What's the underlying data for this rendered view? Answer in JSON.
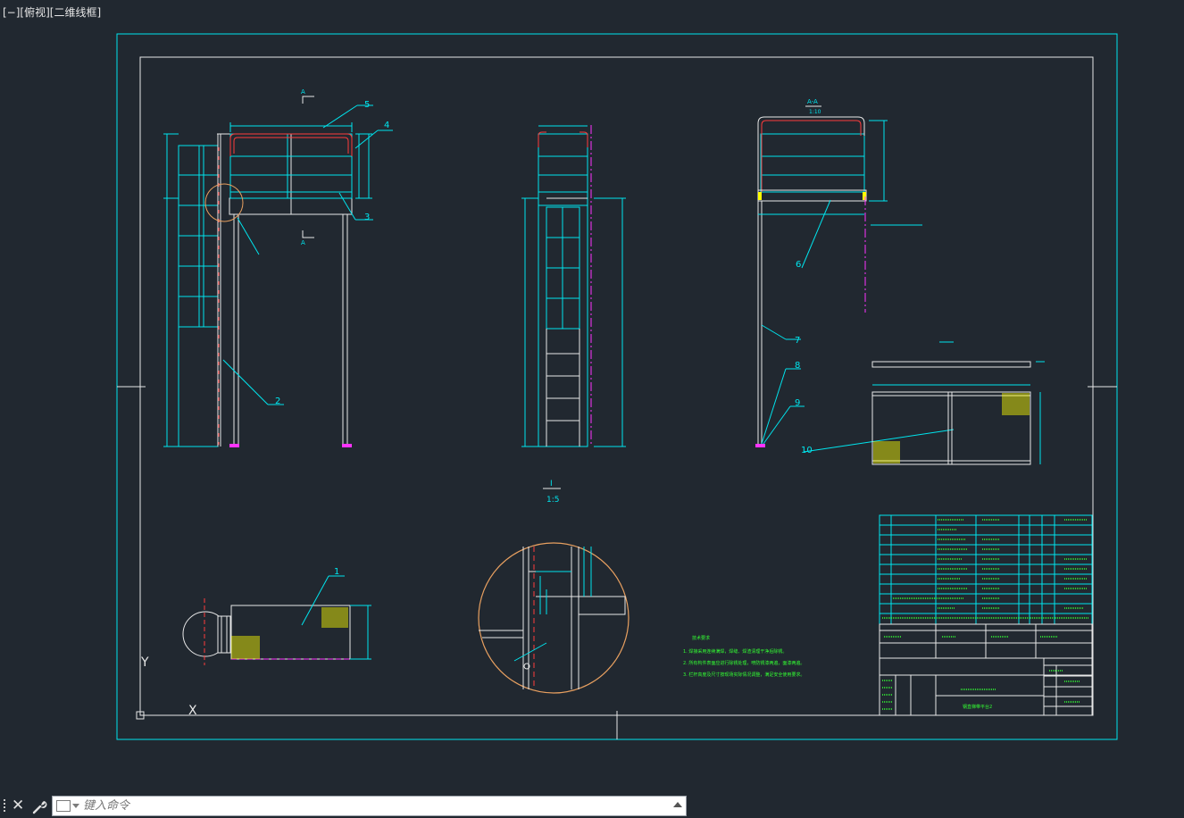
{
  "viewport": {
    "label": "[−][俯视][二维线框]"
  },
  "drawing": {
    "section_label": "A-A",
    "section_scale": "1:10",
    "section_marker": "A",
    "view_label": "I",
    "view_scale": "1:5",
    "callouts": [
      "1",
      "2",
      "3",
      "4",
      "5",
      "6",
      "7",
      "8",
      "9",
      "10"
    ],
    "ucs": {
      "x": "X",
      "y": "Y"
    },
    "notes_title": "技术要求",
    "notes": [
      "1. 焊接采用连续满焊，焊缝、焊渣清理干净后除锈。",
      "2. 所有构件表面应进行除锈处理，喷防锈漆两遍，面漆两遍。",
      "3. 栏杆高度及尺寸按现场实际情况调整，满足安全使用要求。"
    ],
    "title_block_name": "钢直梯带平台2"
  },
  "colors": {
    "background": "#212830",
    "cyan": "#00e5ee",
    "white": "#e8e8e8",
    "green": "#33ff33",
    "red": "#ff3b3b",
    "magenta": "#ff33ff",
    "yellow": "#ffff00",
    "orange": "#e8a060"
  },
  "command": {
    "placeholder": "键入命令",
    "close_icon": "close-icon",
    "settings_icon": "wrench-icon"
  }
}
